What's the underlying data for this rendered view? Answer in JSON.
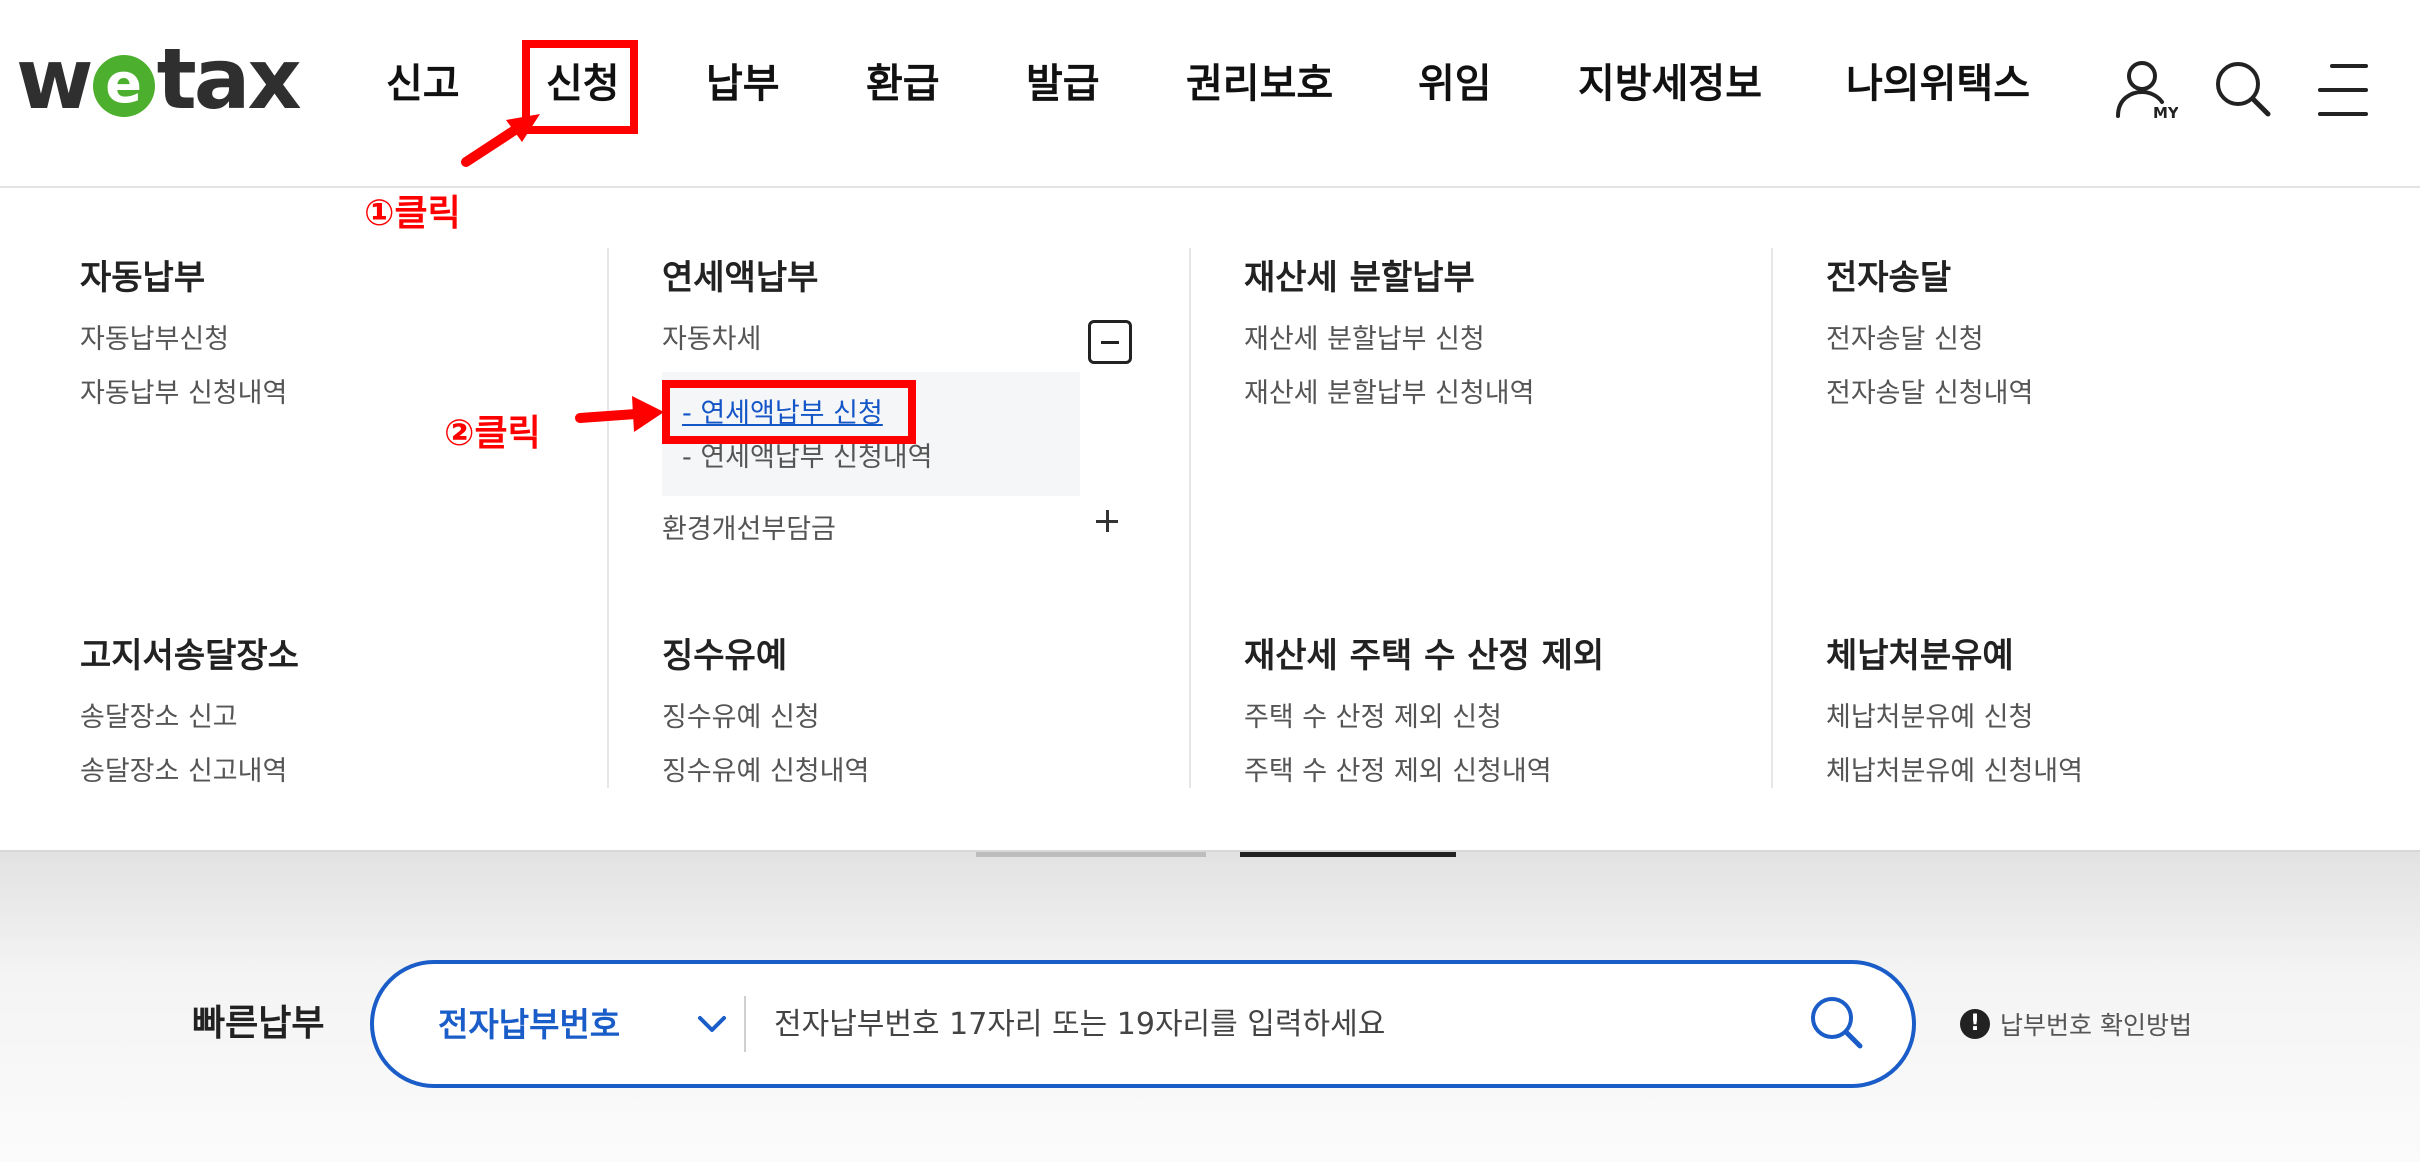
{
  "header": {
    "logo": {
      "w": "w",
      "e": "e",
      "tax": "tax"
    },
    "nav": [
      {
        "label": "신고"
      },
      {
        "label": "신청"
      },
      {
        "label": "납부"
      },
      {
        "label": "환급"
      },
      {
        "label": "발급"
      },
      {
        "label": "권리보호"
      },
      {
        "label": "위임"
      },
      {
        "label": "지방세정보"
      },
      {
        "label": "나의위택스"
      }
    ],
    "icons": {
      "my": "user-my-icon",
      "search": "search-icon",
      "menu": "menu-icon"
    },
    "my_badge": "MY"
  },
  "annotations": {
    "step1": "①클릭",
    "step2": "②클릭",
    "color": "#ff0000"
  },
  "mega_menu": {
    "groups": [
      {
        "title": "자동납부",
        "links": [
          "자동납부신청",
          "자동납부 신청내역"
        ]
      },
      {
        "title": "연세액납부",
        "links": [
          "자동차세",
          "환경개선부담금"
        ],
        "expanded_sub": [
          "- 연세액납부 신청",
          "- 연세액납부 신청내역"
        ]
      },
      {
        "title": "재산세 분할납부",
        "links": [
          "재산세 분할납부 신청",
          "재산세 분할납부 신청내역"
        ]
      },
      {
        "title": "전자송달",
        "links": [
          "전자송달 신청",
          "전자송달 신청내역"
        ]
      },
      {
        "title": "고지서송달장소",
        "links": [
          "송달장소 신고",
          "송달장소 신고내역"
        ]
      },
      {
        "title": "징수유예",
        "links": [
          "징수유예 신청",
          "징수유예 신청내역"
        ]
      },
      {
        "title": "재산세 주택 수 산정 제외",
        "links": [
          "주택 수 산정 제외 신청",
          "주택 수 산정 제외 신청내역"
        ]
      },
      {
        "title": "체납처분유예",
        "links": [
          "체납처분유예 신청",
          "체납처분유예 신청내역"
        ]
      }
    ]
  },
  "quick_pay": {
    "label": "빠른납부",
    "select_value": "전자납부번호",
    "placeholder": "전자납부번호 17자리 또는 19자리를 입력하세요",
    "help_text": "납부번호 확인방법"
  },
  "colors": {
    "accent": "#1a5cc8",
    "link_active": "#1456c7",
    "logo_green": "#4caf2d"
  }
}
